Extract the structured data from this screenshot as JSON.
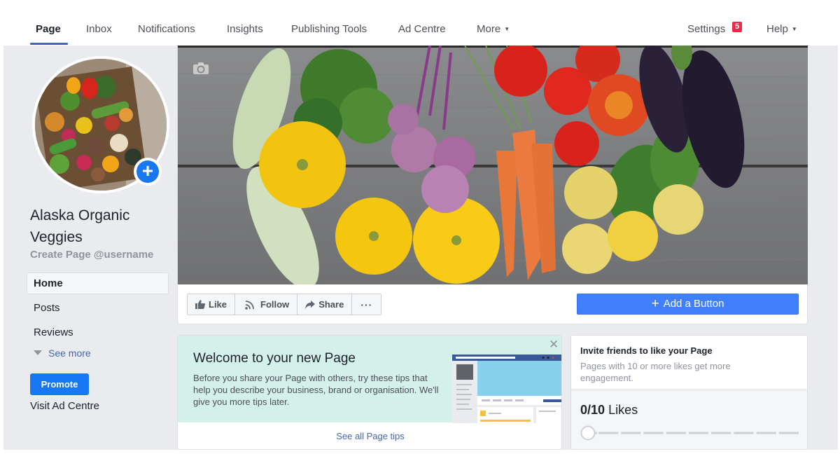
{
  "nav": {
    "tabs": [
      {
        "label": "Page",
        "active": true
      },
      {
        "label": "Inbox"
      },
      {
        "label": "Notifications"
      },
      {
        "label": "Insights"
      },
      {
        "label": "Publishing Tools"
      },
      {
        "label": "Ad Centre"
      },
      {
        "label": "More"
      }
    ],
    "settings_label": "Settings",
    "settings_badge": "5",
    "help_label": "Help"
  },
  "profile": {
    "page_name": "Alaska Organic Veggies",
    "username_prompt": "Create Page @username",
    "add_photo_icon": "plus-icon"
  },
  "sidebar": {
    "items": [
      {
        "label": "Home",
        "active": true
      },
      {
        "label": "Posts"
      },
      {
        "label": "Reviews"
      }
    ],
    "see_more": "See more",
    "promote": "Promote",
    "visit_ad_centre": "Visit Ad Centre"
  },
  "actions": {
    "like": "Like",
    "follow": "Follow",
    "share": "Share",
    "more": "···",
    "add_button": "Add a Button"
  },
  "welcome": {
    "title": "Welcome to your new Page",
    "body": "Before you share your Page with others, try these tips that help you describe your business, brand or organisation. We'll give you more tips later.",
    "close": "✕",
    "link": "See all Page tips"
  },
  "invite": {
    "title": "Invite friends to like your Page",
    "subtitle": "Pages with 10 or more likes get more engagement.",
    "likes_current": "0/10",
    "likes_label": "Likes",
    "progress_value": 0,
    "progress_goal": 10
  },
  "colors": {
    "brand_blue": "#4267b2",
    "button_blue": "#4080ff",
    "promote_blue": "#1877f2",
    "badge_red": "#f02849",
    "welcome_bg": "#d4f0eb",
    "page_bg": "#e9ebee"
  }
}
